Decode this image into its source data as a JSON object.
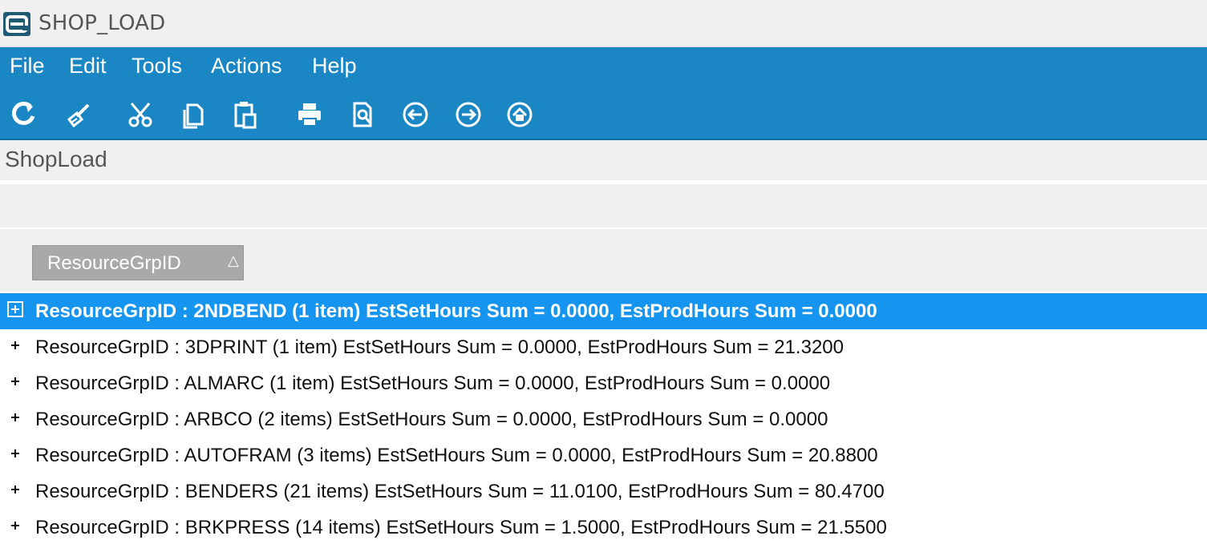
{
  "window": {
    "title": "SHOP_LOAD"
  },
  "menu": {
    "items": [
      "File",
      "Edit",
      "Tools",
      "Actions",
      "Help"
    ]
  },
  "toolbar": {
    "buttons": [
      "refresh-icon",
      "clear-icon",
      "cut-icon",
      "copy-icon",
      "paste-icon",
      "print-icon",
      "print-preview-icon",
      "back-icon",
      "forward-icon",
      "home-icon"
    ]
  },
  "form": {
    "label": "ShopLoad"
  },
  "grid": {
    "group_by": {
      "column": "ResourceGrpID",
      "sort_glyph": "△"
    },
    "rows": [
      {
        "text": "ResourceGrpID : 2NDBEND (1 item) EstSetHours Sum = 0.0000, EstProdHours Sum = 0.0000",
        "selected": true
      },
      {
        "text": "ResourceGrpID : 3DPRINT (1 item) EstSetHours Sum = 0.0000, EstProdHours Sum = 21.3200",
        "selected": false
      },
      {
        "text": "ResourceGrpID : ALMARC (1 item) EstSetHours Sum = 0.0000, EstProdHours Sum = 0.0000",
        "selected": false
      },
      {
        "text": "ResourceGrpID : ARBCO (2 items) EstSetHours Sum = 0.0000, EstProdHours Sum = 0.0000",
        "selected": false
      },
      {
        "text": "ResourceGrpID : AUTOFRAM (3 items) EstSetHours Sum = 0.0000, EstProdHours Sum = 20.8800",
        "selected": false
      },
      {
        "text": "ResourceGrpID : BENDERS (21 items) EstSetHours Sum = 11.0100, EstProdHours Sum = 80.4700",
        "selected": false
      },
      {
        "text": "ResourceGrpID : BRKPRESS (14 items) EstSetHours Sum = 1.5000, EstProdHours Sum = 21.5500",
        "selected": false
      }
    ]
  },
  "colors": {
    "menubar": "#1a87c4",
    "selected_row": "#1594f0",
    "group_chip": "#a9a9a9"
  }
}
